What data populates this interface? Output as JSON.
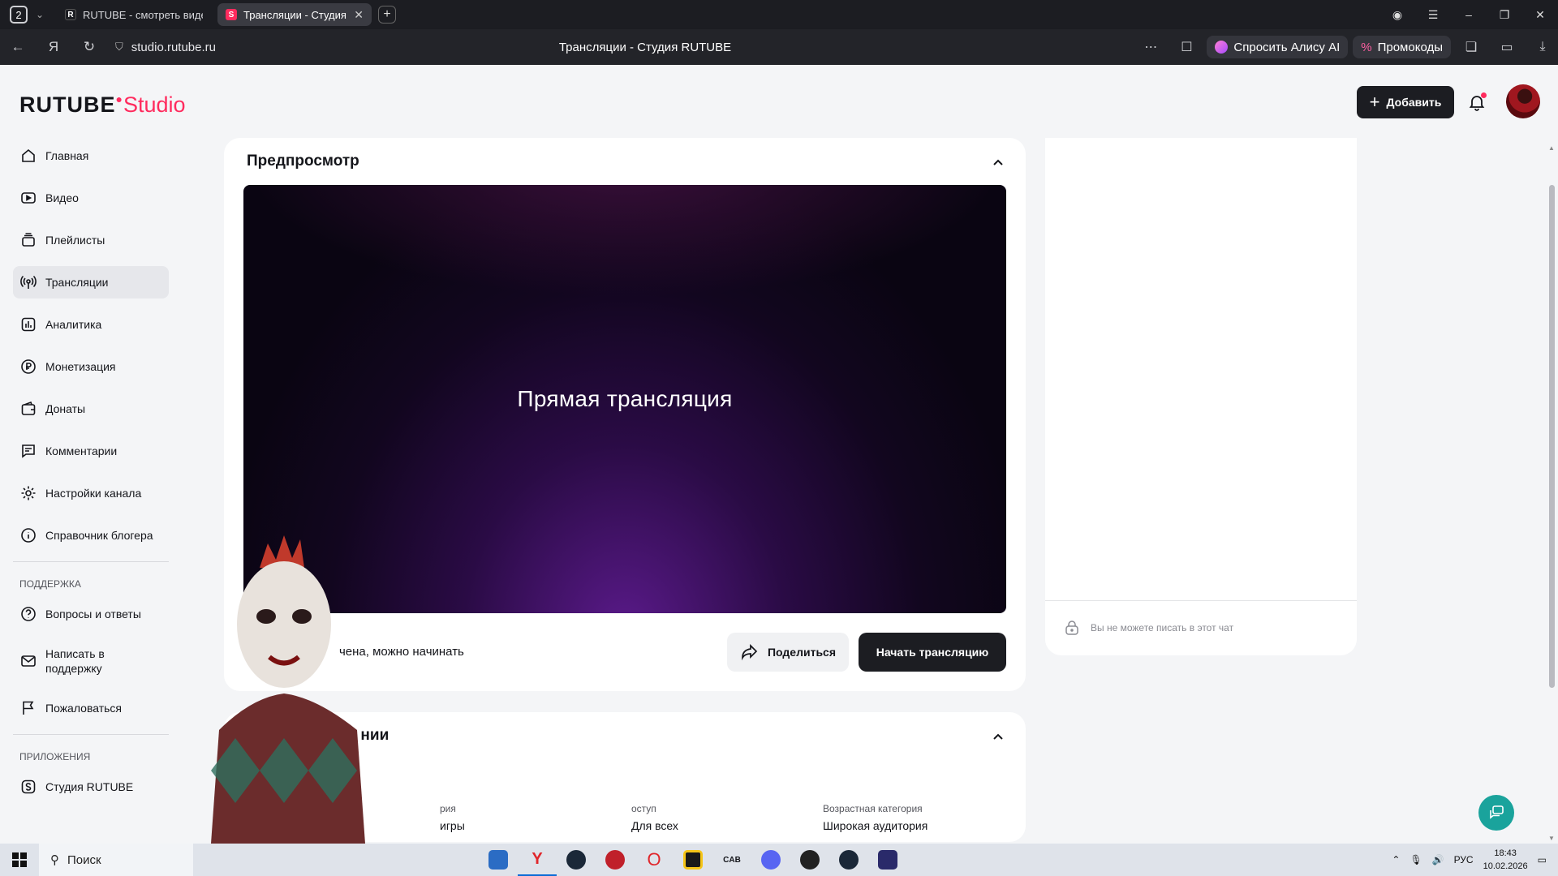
{
  "browser": {
    "tab_count": "2",
    "tabs": [
      {
        "title": "RUTUBE - смотреть виде",
        "favicon": "R"
      },
      {
        "title": "Трансляции - Студия R",
        "favicon": "S"
      }
    ],
    "url": "studio.rutube.ru",
    "page_title": "Трансляции - Студия RUTUBE",
    "alice_label": "Спросить Алису AI",
    "promo_label": "Промокоды"
  },
  "header": {
    "logo_main": "RUTUBE",
    "logo_studio": "Studio",
    "add_label": "Добавить"
  },
  "sidebar": {
    "items": [
      {
        "label": "Главная",
        "icon": "home-icon"
      },
      {
        "label": "Видео",
        "icon": "video-icon"
      },
      {
        "label": "Плейлисты",
        "icon": "playlist-icon"
      },
      {
        "label": "Трансляции",
        "icon": "broadcast-icon"
      },
      {
        "label": "Аналитика",
        "icon": "analytics-icon"
      },
      {
        "label": "Монетизация",
        "icon": "ruble-icon"
      },
      {
        "label": "Донаты",
        "icon": "wallet-icon"
      },
      {
        "label": "Комментарии",
        "icon": "comment-icon"
      },
      {
        "label": "Настройки канала",
        "icon": "gear-icon"
      },
      {
        "label": "Справочник блогера",
        "icon": "info-icon"
      }
    ],
    "support_title": "ПОДДЕРЖКА",
    "support_items": [
      {
        "label": "Вопросы и ответы"
      },
      {
        "label": "Написать в поддержку"
      },
      {
        "label": "Пожаловаться"
      }
    ],
    "apps_title": "ПРИЛОЖЕНИЯ",
    "apps_items": [
      {
        "label": "Студия RUTUBE"
      }
    ]
  },
  "preview": {
    "title": "Предпросмотр",
    "player_label": "Прямая трансляция",
    "status_text": "Пр                 чена, можно начинать",
    "share_label": "Поделиться",
    "start_label": "Начать трансляцию"
  },
  "chat": {
    "locked_text": "Вы не можете писать в этот чат"
  },
  "settings": {
    "title_visible": "Н                        нии",
    "meta": [
      {
        "label": "рия",
        "value": "игры"
      },
      {
        "label": "оступ",
        "value": "Для всех"
      },
      {
        "label": "Возрастная категория",
        "value": "Широкая аудитория"
      }
    ]
  },
  "taskbar": {
    "search_placeholder": "Поиск",
    "lang": "РУС",
    "time": "18:43",
    "date": "10.02.2026"
  },
  "colors": {
    "accent": "#ff2b5e",
    "dark_button": "#1c1d22",
    "help_fab": "#1aa39c"
  }
}
